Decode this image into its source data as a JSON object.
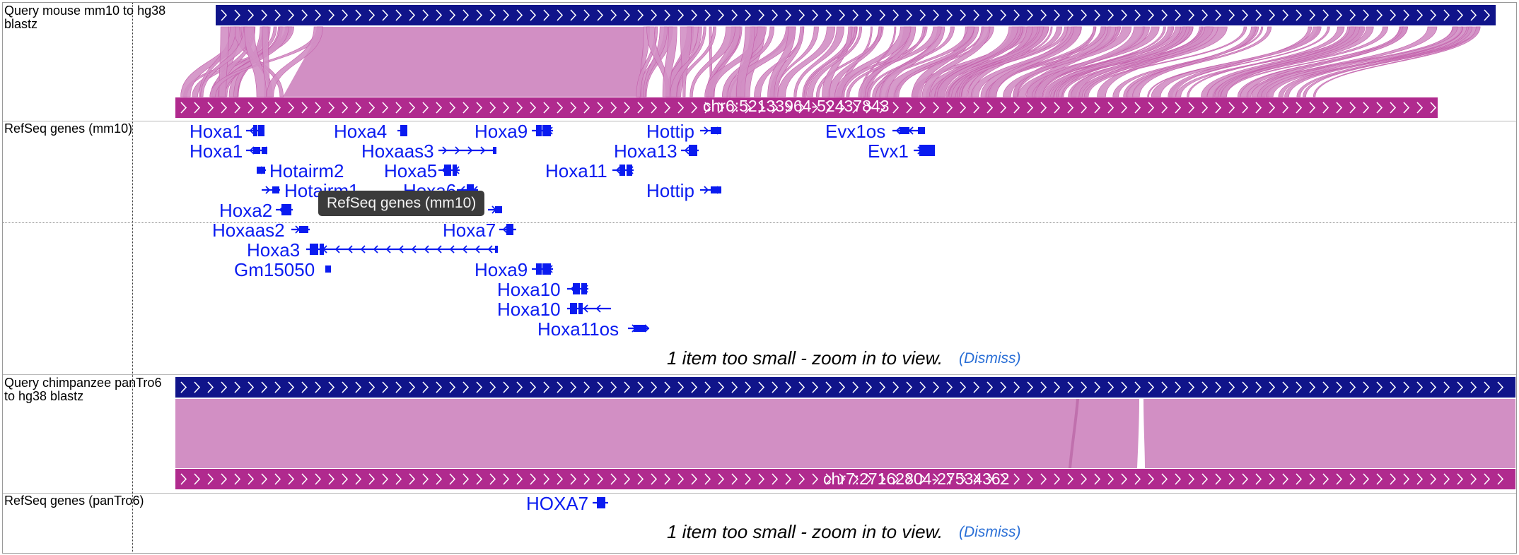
{
  "colors": {
    "query_bar": "#10148a",
    "target_bar": "#b02a8e",
    "alignment_fill": "#d28fc4",
    "alignment_line": "#c35fab",
    "gene": "#0a1bf0",
    "dismiss_link": "#2a6fd6"
  },
  "tracks": [
    {
      "id": "mm10-blastz",
      "label": "Query mouse mm10 to hg38 blastz"
    },
    {
      "id": "refseq-mm10",
      "label": "RefSeq genes (mm10)"
    },
    {
      "id": "pantro6-blastz",
      "label": "Query chimpanzee panTro6 to hg38 blastz"
    },
    {
      "id": "refseq-pantro6",
      "label": "RefSeq genes (panTro6)"
    }
  ],
  "mm10_chain": {
    "target_region": "chr6:52133964-52437843"
  },
  "pantro6_chain": {
    "target_region": "chr7:27162804-27534362"
  },
  "mm10_genes": [
    {
      "name": "Hoxa1",
      "strand": "-"
    },
    {
      "name": "Hoxa4",
      "strand": "-"
    },
    {
      "name": "Hoxa9",
      "strand": "-"
    },
    {
      "name": "Hottip",
      "strand": "+"
    },
    {
      "name": "Evx1os",
      "strand": "-"
    },
    {
      "name": "Hoxa1",
      "strand": "-"
    },
    {
      "name": "Hoxaas3",
      "strand": "+"
    },
    {
      "name": "Hoxa13",
      "strand": "-"
    },
    {
      "name": "Evx1",
      "strand": "+"
    },
    {
      "name": "Hotairm2",
      "strand": "+"
    },
    {
      "name": "Hoxa5",
      "strand": "-"
    },
    {
      "name": "Hoxa11",
      "strand": "-"
    },
    {
      "name": "Hotairm1",
      "strand": "+"
    },
    {
      "name": "Hoxa6",
      "strand": "-"
    },
    {
      "name": "Hottip",
      "strand": "+"
    },
    {
      "name": "Hoxa2",
      "strand": "-"
    },
    {
      "name": "Hoxaas2",
      "strand": "+"
    },
    {
      "name": "Hoxa7",
      "strand": "-"
    },
    {
      "name": "Hoxa3",
      "strand": "-"
    },
    {
      "name": "Gm15050",
      "strand": "+"
    },
    {
      "name": "Hoxa9",
      "strand": "-"
    },
    {
      "name": "Hoxa10",
      "strand": "-"
    },
    {
      "name": "Hoxa10",
      "strand": "-"
    },
    {
      "name": "Hoxa11os",
      "strand": "+"
    }
  ],
  "pantro6_genes": [
    {
      "name": "HOXA7",
      "strand": "-"
    }
  ],
  "messages": {
    "too_small": "1 item too small - zoom in to view.",
    "dismiss": "(Dismiss)"
  },
  "tooltip": "RefSeq genes (mm10)"
}
